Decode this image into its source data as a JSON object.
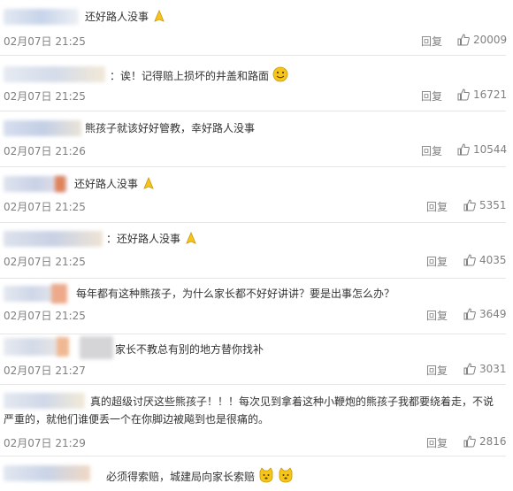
{
  "comments": [
    {
      "text": "还好路人没事",
      "emoji": "pray-icon",
      "time": "02月07日 21:25",
      "reply": "回复",
      "likes": "20009"
    },
    {
      "text": "：诶！记得赔上损坏的井盖和路面",
      "emoji": "smile-icon",
      "time": "02月07日 21:25",
      "reply": "回复",
      "likes": "16721"
    },
    {
      "text": "熊孩子就该好好管教，幸好路人没事",
      "emoji": "",
      "time": "02月07日 21:26",
      "reply": "回复",
      "likes": "10544"
    },
    {
      "text": "还好路人没事",
      "emoji": "pray-icon",
      "time": "02月07日 21:25",
      "reply": "回复",
      "likes": "5351"
    },
    {
      "text": "：还好路人没事",
      "emoji": "pray-icon",
      "time": "02月07日 21:25",
      "reply": "回复",
      "likes": "4035"
    },
    {
      "text": "每年都有这种熊孩子，为什么家长都不好好讲讲？要是出事怎么办？",
      "emoji": "",
      "time": "02月07日 21:25",
      "reply": "回复",
      "likes": "3649"
    },
    {
      "text": "家长不教总有别的地方替你找补",
      "emoji": "",
      "time": "02月07日 21:27",
      "reply": "回复",
      "likes": "3031"
    },
    {
      "text": "真的超级讨厌这些熊孩子！！！每次见到拿着这种小鞭炮的熊孩子我都要绕着走，不说严重的，就他们谁便丢一个在你脚边被飚到也是很痛的。",
      "emoji": "",
      "time": "02月07日 21:29",
      "reply": "回复",
      "likes": "2816"
    },
    {
      "text": "必须得索赔，城建局向家长索赔",
      "emoji": "doge-icon",
      "time": "",
      "reply": "",
      "likes": ""
    }
  ],
  "colors": {
    "text": "#333333",
    "meta": "#808080",
    "divider": "#e6e6e6",
    "emoji": "#f5c518"
  }
}
